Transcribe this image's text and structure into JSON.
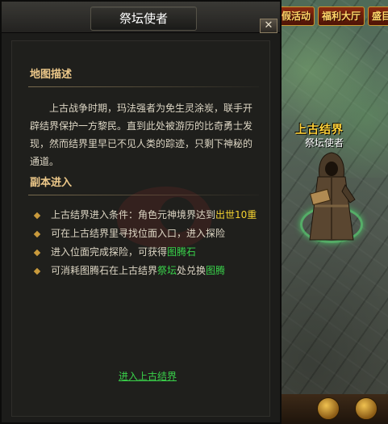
{
  "dialog": {
    "title": "祭坛使者",
    "close_label": "✕",
    "section_map": {
      "title": "地图描述",
      "description": "上古战争时期，玛法强者为免生灵涂炭，联手开辟结界保护一方黎民。直到此处被游历的比奇勇士发现，然而结界里早已不见人类的踪迹，只剩下神秘的通道。"
    },
    "section_instance": {
      "title": "副本进入",
      "items": [
        {
          "text": "上古结界进入条件：角色元神境界达到",
          "highlight": "出世10重",
          "highlight_color": "#f4d230"
        },
        {
          "text": "可在上古结界里寻找位面入口，进入探险"
        },
        {
          "text": "进入位面完成探险，可获得",
          "highlight": "图腾石",
          "highlight_color": "#39d24a"
        },
        {
          "text": "可消耗图腾石在上古结界",
          "highlight": "祭坛",
          "highlight_color": "#39d24a",
          "text2": "处兑换",
          "highlight2": "图腾",
          "highlight2_color": "#39d24a"
        }
      ]
    },
    "enter_link": "进入上古结界"
  },
  "scene": {
    "npc_area_name": "上古结界",
    "npc_title": "祭坛使者",
    "top_menu": [
      "假活动",
      "福利大厅",
      "盛目"
    ]
  },
  "colors": {
    "dialog_bg": "#1c1c1a",
    "section_title": "#eec98a",
    "body_text": "#ddd6c4",
    "highlight_green": "#39d24a",
    "highlight_yellow": "#f4d230",
    "npc_name": "#ffd23a"
  }
}
